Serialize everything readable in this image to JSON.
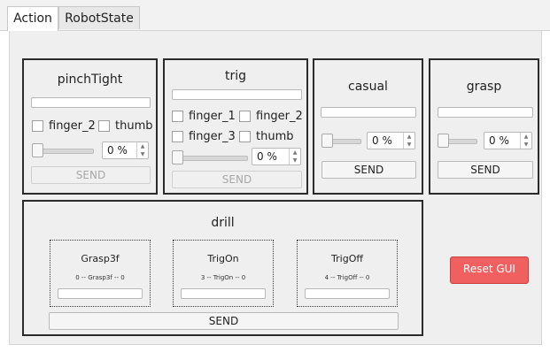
{
  "tabs": [
    {
      "label": "Action",
      "active": true
    },
    {
      "label": "RobotState",
      "active": false
    }
  ],
  "groups": {
    "pinchTight": {
      "title": "pinchTight",
      "text_value": "",
      "checkboxes": [
        {
          "label": "finger_2",
          "checked": false
        },
        {
          "label": "thumb",
          "checked": false
        }
      ],
      "slider_percent": 0,
      "spin_value": "0 %",
      "send_label": "SEND",
      "send_enabled": false
    },
    "trig": {
      "title": "trig",
      "text_value": "",
      "checkboxes": [
        {
          "label": "finger_1",
          "checked": false
        },
        {
          "label": "finger_2",
          "checked": false
        },
        {
          "label": "finger_3",
          "checked": false
        },
        {
          "label": "thumb",
          "checked": false
        }
      ],
      "slider_percent": 0,
      "spin_value": "0 %",
      "send_label": "SEND",
      "send_enabled": false
    },
    "casual": {
      "title": "casual",
      "text_value": "",
      "slider_percent": 0,
      "spin_value": "0 %",
      "send_label": "SEND"
    },
    "grasp": {
      "title": "grasp",
      "text_value": "",
      "slider_percent": 0,
      "spin_value": "0 %",
      "send_label": "SEND"
    },
    "drill": {
      "title": "drill",
      "subs": [
        {
          "title": "Grasp3f",
          "info": "0 -- Grasp3f -- 0",
          "text_value": ""
        },
        {
          "title": "TrigOn",
          "info": "3 -- TrigOn -- 0",
          "text_value": ""
        },
        {
          "title": "TrigOff",
          "info": "4 -- TrigOff -- 0",
          "text_value": ""
        }
      ],
      "send_label": "SEND"
    }
  },
  "reset": {
    "label": "Reset GUI",
    "color": "#f06060"
  }
}
